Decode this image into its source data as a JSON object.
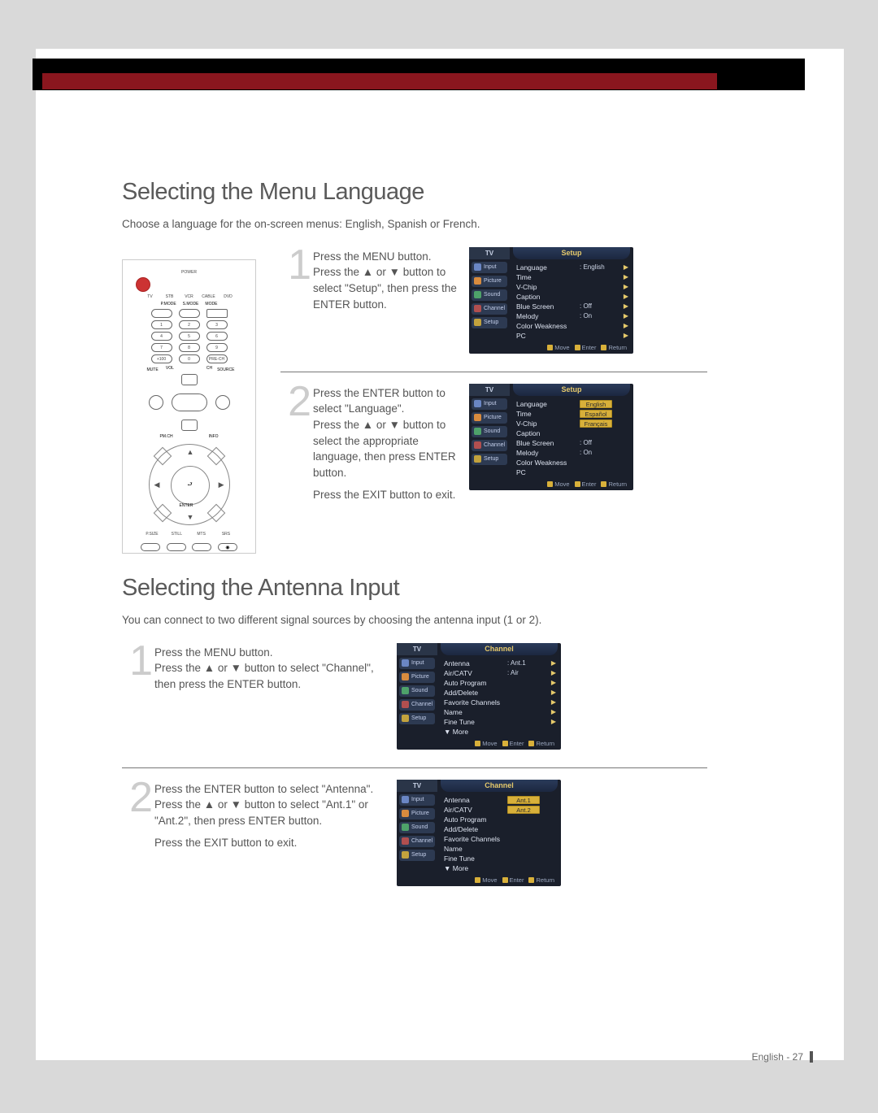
{
  "section1": {
    "heading": "Selecting the Menu Language",
    "intro": "Choose a language for the on-screen menus: English, Spanish or French.",
    "step1": {
      "num": "1",
      "text": "Press the MENU button.\nPress the ▲ or ▼ button to select \"Setup\", then press the ENTER button."
    },
    "step2": {
      "num": "2",
      "text1": "Press the ENTER button to select \"Language\".\nPress the ▲ or ▼ button to select the appropriate language, then press ENTER button.",
      "text2": "Press the EXIT button to exit."
    }
  },
  "section2": {
    "heading": "Selecting the Antenna Input",
    "intro": "You can connect to two different signal sources by choosing the antenna input (1 or 2).",
    "step1": {
      "num": "1",
      "text": "Press the MENU button.\nPress the ▲ or ▼ button to select \"Channel\", then press the ENTER button."
    },
    "step2": {
      "num": "2",
      "text1": "Press the ENTER button to select \"Antenna\".\nPress the ▲ or ▼ button to select \"Ant.1\" or \"Ant.2\", then press ENTER button.",
      "text2": "Press the EXIT button to exit."
    }
  },
  "remote": {
    "power": "POWER",
    "devices": [
      "TV",
      "STB",
      "VCR",
      "CABLE",
      "DVD"
    ],
    "pmode": "P.MODE",
    "smode": "S.MODE",
    "mode": "MODE",
    "nums": [
      [
        "1",
        "2",
        "3"
      ],
      [
        "4",
        "5",
        "6"
      ],
      [
        "7",
        "8",
        "9"
      ],
      [
        "+100",
        "0",
        "PRE-CH"
      ]
    ],
    "vol": "VOL",
    "ch": "CH",
    "mute": "MUTE",
    "source": "SOURCE",
    "pmlch": "PM.CH",
    "info": "INFO",
    "enter": "ENTER",
    "bottom": [
      "P.SIZE",
      "STILL",
      "MTS",
      "SRS"
    ]
  },
  "osd": {
    "tv": "TV",
    "tabs": [
      "Input",
      "Picture",
      "Sound",
      "Channel",
      "Setup"
    ],
    "setup": {
      "title": "Setup",
      "items": [
        {
          "k": "Language",
          "v": ": English"
        },
        {
          "k": "Time",
          "v": ""
        },
        {
          "k": "V-Chip",
          "v": ""
        },
        {
          "k": "Caption",
          "v": ""
        },
        {
          "k": "Blue Screen",
          "v": ": Off"
        },
        {
          "k": "Melody",
          "v": ": On"
        },
        {
          "k": "Color Weakness",
          "v": ""
        },
        {
          "k": "PC",
          "v": ""
        }
      ],
      "lang_opts": [
        "English",
        "Español",
        "Français"
      ]
    },
    "channel": {
      "title": "Channel",
      "items": [
        {
          "k": "Antenna",
          "v": ": Ant.1"
        },
        {
          "k": "Air/CATV",
          "v": ": Air"
        },
        {
          "k": "Auto Program",
          "v": ""
        },
        {
          "k": "Add/Delete",
          "v": ""
        },
        {
          "k": "Favorite Channels",
          "v": ""
        },
        {
          "k": "Name",
          "v": ""
        },
        {
          "k": "Fine Tune",
          "v": ""
        },
        {
          "k": "▼ More",
          "v": ""
        }
      ],
      "ant_opts": [
        "Ant.1",
        "Ant.2"
      ]
    },
    "footer": {
      "move": "Move",
      "enter": "Enter",
      "return": "Return"
    }
  },
  "footer": "English - 27"
}
